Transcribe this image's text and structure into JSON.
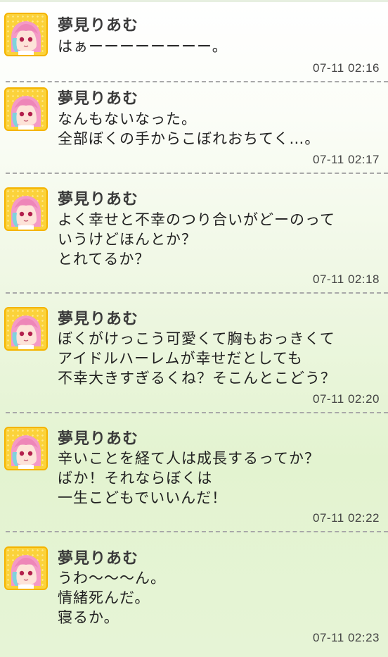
{
  "posts": [
    {
      "name": "夢見りあむ",
      "lines": [
        "はぁーーーーーーーー。"
      ],
      "time": "07-11 02:16"
    },
    {
      "name": "夢見りあむ",
      "lines": [
        "なんもないなった。",
        "全部ぼくの手からこぼれおちてく…。"
      ],
      "time": "07-11 02:17"
    },
    {
      "name": "夢見りあむ",
      "lines": [
        "よく幸せと不幸のつり合いがどーのって",
        "いうけどほんとか？",
        "とれてるか？"
      ],
      "time": "07-11 02:18"
    },
    {
      "name": "夢見りあむ",
      "lines": [
        "ぼくがけっこう可愛くて胸もおっきくて",
        "アイドルハーレムが幸せだとしても",
        "不幸大きすぎるくね？そこんとこどう？"
      ],
      "time": "07-11 02:20"
    },
    {
      "name": "夢見りあむ",
      "lines": [
        "辛いことを経て人は成長するってか？",
        "ばか！それならぼくは",
        "一生こどもでいいんだ！"
      ],
      "time": "07-11 02:22"
    },
    {
      "name": "夢見りあむ",
      "lines": [
        "うわ〜〜〜ん。",
        "情緒死んだ。",
        "寝るか。"
      ],
      "time": "07-11 02:23"
    }
  ]
}
